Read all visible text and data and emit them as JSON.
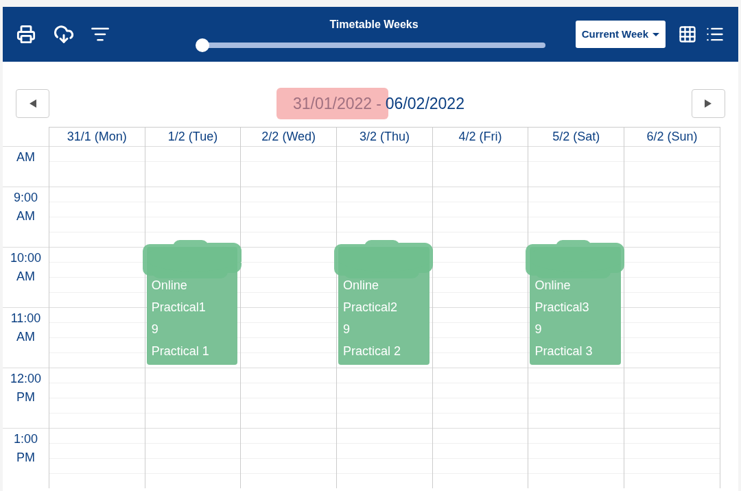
{
  "toolbar": {
    "slider": {
      "title": "Timetable Weeks",
      "level": 0
    },
    "week_select": {
      "value": "Current Week"
    }
  },
  "date_range": {
    "start": "31/01/2022",
    "separator": "-",
    "end": "06/02/2022",
    "start_highlighted": true
  },
  "time_slots": [
    {
      "lines": [
        "AM"
      ]
    },
    {
      "lines": [
        "9:00",
        "AM"
      ]
    },
    {
      "lines": [
        "10:00",
        "AM"
      ]
    },
    {
      "lines": [
        "11:00",
        "AM"
      ]
    },
    {
      "lines": [
        "12:00",
        "PM"
      ]
    },
    {
      "lines": [
        "1:00",
        "PM"
      ]
    }
  ],
  "days": [
    {
      "label": "31/1 (Mon)"
    },
    {
      "label": "1/2 (Tue)",
      "events": [
        {
          "lines": [
            "Online",
            "Practical1",
            "9",
            "Practical 1"
          ],
          "redacted": true
        }
      ]
    },
    {
      "label": "2/2 (Wed)"
    },
    {
      "label": "3/2 (Thu)",
      "events": [
        {
          "lines": [
            "Online",
            "Practical2",
            "9",
            "Practical 2"
          ],
          "redacted": true
        }
      ]
    },
    {
      "label": "4/2 (Fri)"
    },
    {
      "label": "5/2 (Sat)",
      "events": [
        {
          "lines": [
            "Online",
            "Practical3",
            "9",
            "Practical 3"
          ],
          "redacted": true
        }
      ]
    },
    {
      "label": "6/2 (Sun)"
    }
  ]
}
